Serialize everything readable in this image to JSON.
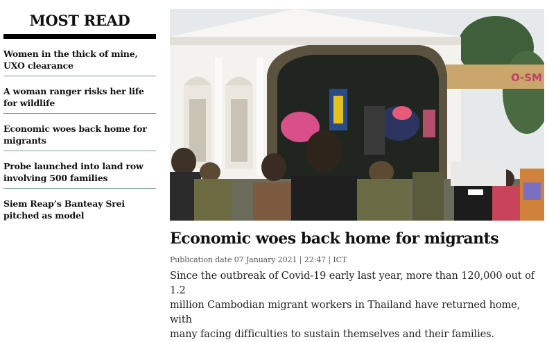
{
  "most_read": {
    "title": "MOST READ",
    "items": [
      {
        "line1": "Women in the thick of mine,",
        "line2": "UXO clearance"
      },
      {
        "line1": "A woman ranger risks her life",
        "line2": "for wildlife"
      },
      {
        "line1": "Economic woes back home for",
        "line2": "migrants"
      },
      {
        "line1": "Probe launched into land row",
        "line2": "involving 500 families"
      },
      {
        "line1": "Siem Reap’s Banteay Srei",
        "line2": "pitched as model"
      }
    ]
  },
  "article": {
    "headline": "Economic woes back home for migrants",
    "meta": "Publication date 07 January 2021 | 22:47 | ICT",
    "summary": [
      "Since the outbreak of Covid-19 early last year, more than 120,000 out of 1.2",
      "million Cambodian migrant workers in Thailand have returned home, with",
      "many facing difficulties to sustain themselves and their families."
    ],
    "image_sign": "O-SM"
  }
}
